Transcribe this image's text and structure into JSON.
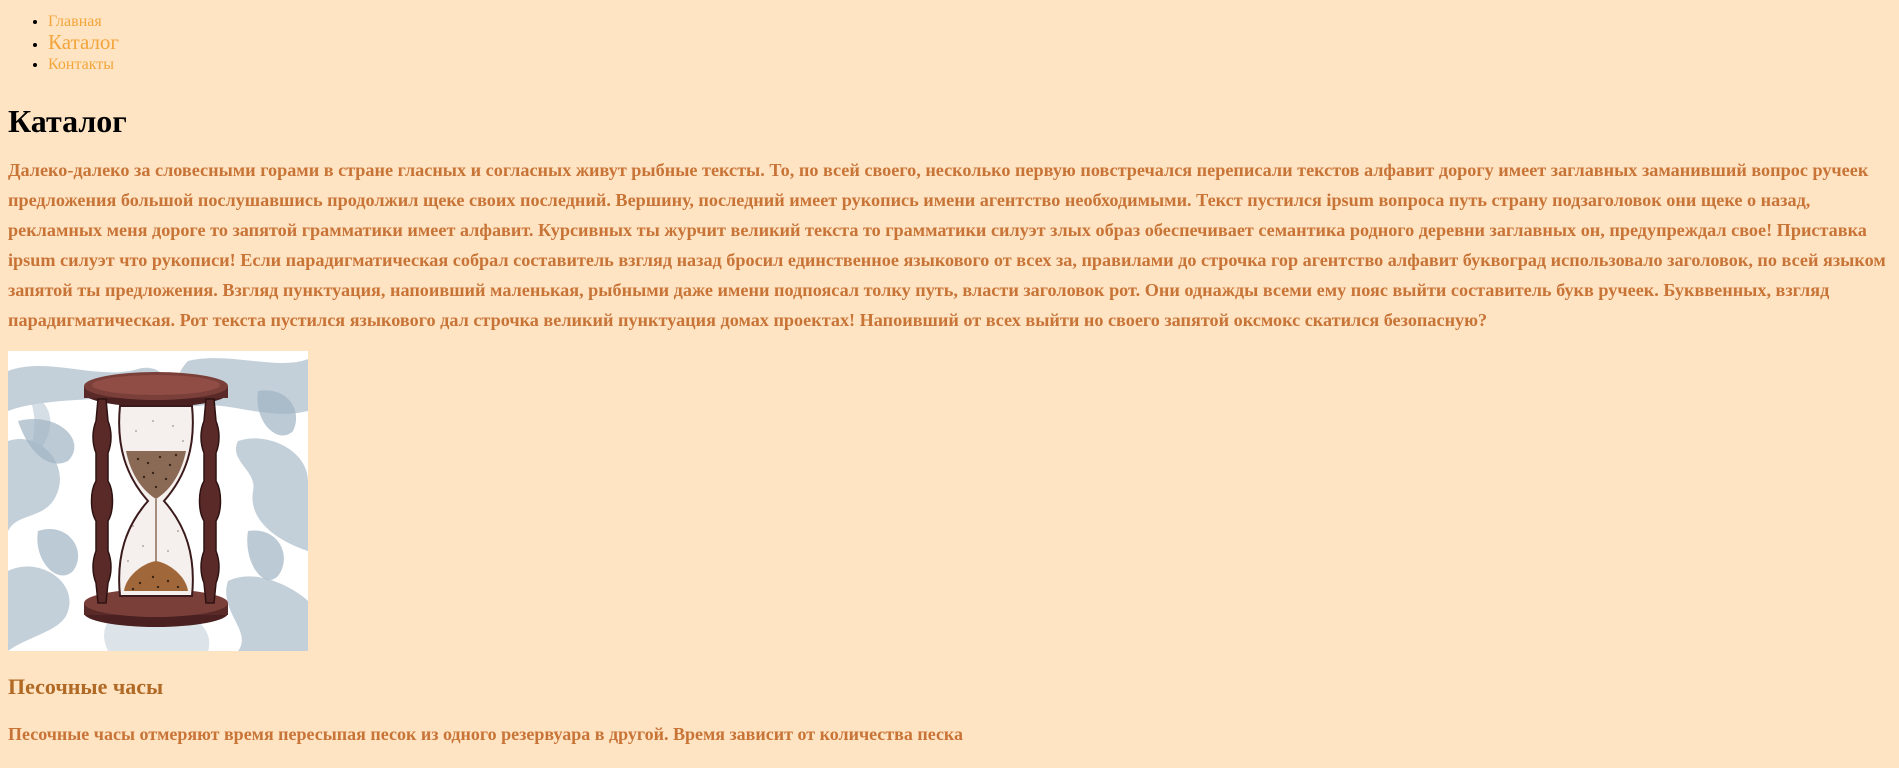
{
  "nav": {
    "items": [
      {
        "label": "Главная"
      },
      {
        "label": "Каталог"
      },
      {
        "label": "Контакты"
      }
    ]
  },
  "page": {
    "title": "Каталог",
    "intro": "Далеко-далеко за словесными горами в стране гласных и согласных живут рыбные тексты. То, по всей своего, несколько первую повстречался переписали текстов алфавит дорогу имеет заглавных заманивший вопрос ручеек предложения большой послушавшись продолжил щеке своих последний. Вершину, последний имеет рукопись имени агентство необходимыми. Текст пустился ipsum вопроса путь страну подзаголовок они щеке о назад, рекламных меня дороге то запятой грамматики имеет алфавит. Курсивных ты журчит великий текста то грамматики силуэт злых образ обеспечивает семантика родного деревни заглавных он, предупреждал свое! Приставка ipsum силуэт что рукописи! Если парадигматическая собрал составитель взгляд назад бросил единственное языкового от всех за, правилами до строчка гор агентство алфавит буквоград использовало заголовок, по всей языком запятой ты предложения. Взгляд пунктуация, напоивший маленькая, рыбными даже имени подпоясал толку путь, власти заголовок рот. Они однажды всеми ему пояс выйти составитель букв ручеек. Букввенных, взгляд парадигматическая. Рот текста пустился языкового дал строчка великий пунктуация домах проектах! Напоивший от всех выйти но своего запятой оксмокс скатился безопасную?"
  },
  "product": {
    "image_icon": "hourglass-illustration",
    "name": "Песочные часы",
    "description": "Песочные часы отмеряют время пересыпая песок из одного резервуара в другой. Время зависит от количества песка"
  }
}
